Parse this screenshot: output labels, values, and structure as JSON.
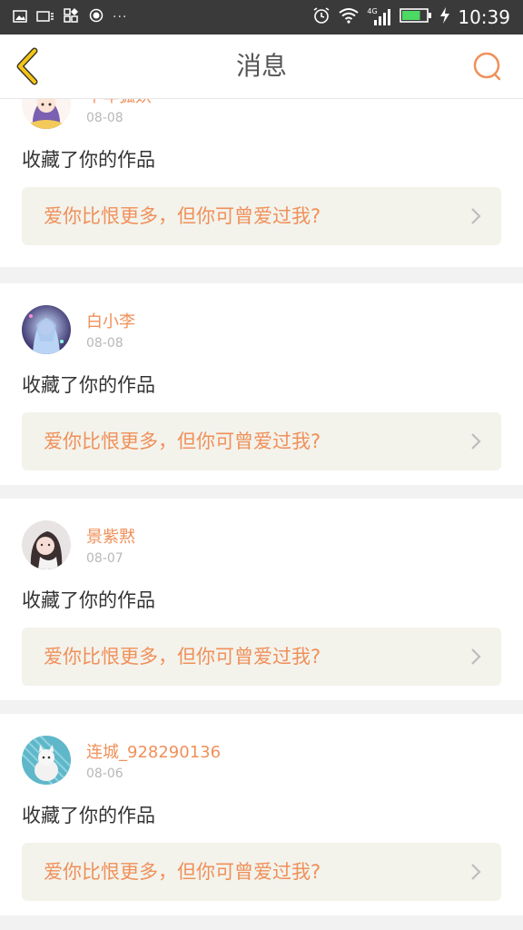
{
  "status_bar": {
    "time": "10:39",
    "more": "···",
    "network": "4G",
    "icons": [
      "image-icon",
      "cast-icon",
      "apps-icon",
      "record-icon",
      "alarm-icon",
      "wifi-icon",
      "signal-icon",
      "battery-icon",
      "charging-icon"
    ],
    "battery_level": 0.75,
    "battery_color": "#4cd964"
  },
  "header": {
    "title": "消息",
    "back_icon": "chevron-left-icon",
    "search_icon": "search-icon",
    "accent_back": "#f5c518",
    "accent_search": "#f0905a"
  },
  "colors": {
    "accent": "#f0905a",
    "work_bg": "#f3f3ec",
    "action_text": "#333333",
    "date_text": "#b8b8b8"
  },
  "messages": [
    {
      "user": "千年狐妖",
      "date": "08-08",
      "action": "收藏了你的作品",
      "work_title": "爱你比恨更多，但你可曾爱过我?"
    },
    {
      "user": "白小李",
      "date": "08-08",
      "action": "收藏了你的作品",
      "work_title": "爱你比恨更多，但你可曾爱过我?"
    },
    {
      "user": "景紫黙",
      "date": "08-07",
      "action": "收藏了你的作品",
      "work_title": "爱你比恨更多，但你可曾爱过我?"
    },
    {
      "user": "连城_928290136",
      "date": "08-06",
      "action": "收藏了你的作品",
      "work_title": "爱你比恨更多，但你可曾爱过我?"
    }
  ]
}
